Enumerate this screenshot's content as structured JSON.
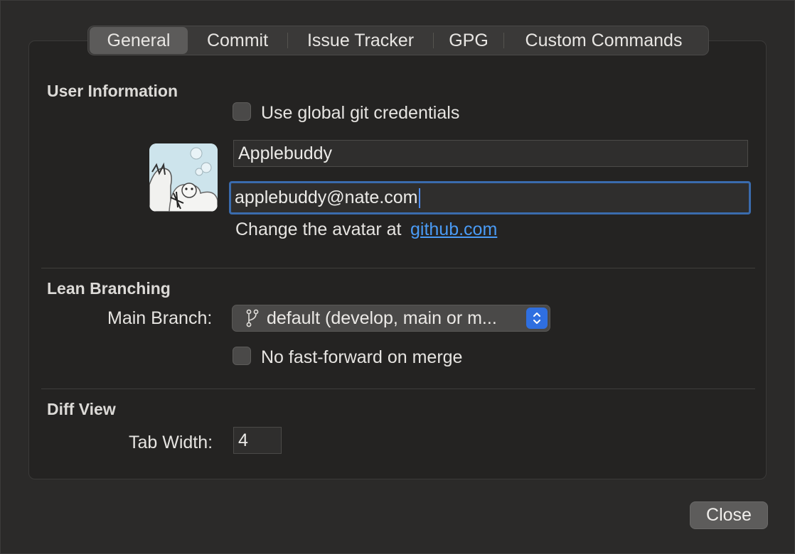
{
  "tabs": [
    {
      "label": "General",
      "active": true
    },
    {
      "label": "Commit",
      "active": false
    },
    {
      "label": "Issue Tracker",
      "active": false
    },
    {
      "label": "GPG",
      "active": false
    },
    {
      "label": "Custom Commands",
      "active": false
    }
  ],
  "user_info": {
    "title": "User Information",
    "global_credentials_label": "Use global git credentials",
    "global_credentials_checked": false,
    "name_value": "Applebuddy",
    "email_value": "applebuddy@nate.com",
    "avatar_hint": "Change the avatar at",
    "avatar_link": "github.com"
  },
  "lean_branching": {
    "title": "Lean Branching",
    "main_branch_label": "Main Branch:",
    "main_branch_value": "default (develop, main or m...",
    "no_ff_label": "No fast-forward on merge",
    "no_ff_checked": false
  },
  "diff_view": {
    "title": "Diff View",
    "tab_width_label": "Tab Width:",
    "tab_width_value": "4"
  },
  "footer": {
    "close_label": "Close"
  },
  "colors": {
    "accent": "#2f6fe0",
    "link": "#4a9bf5",
    "focus_ring": "#3a6bad"
  },
  "icons": {
    "branch": "git-branch-icon",
    "stepper": "up-down-chevron-icon"
  }
}
